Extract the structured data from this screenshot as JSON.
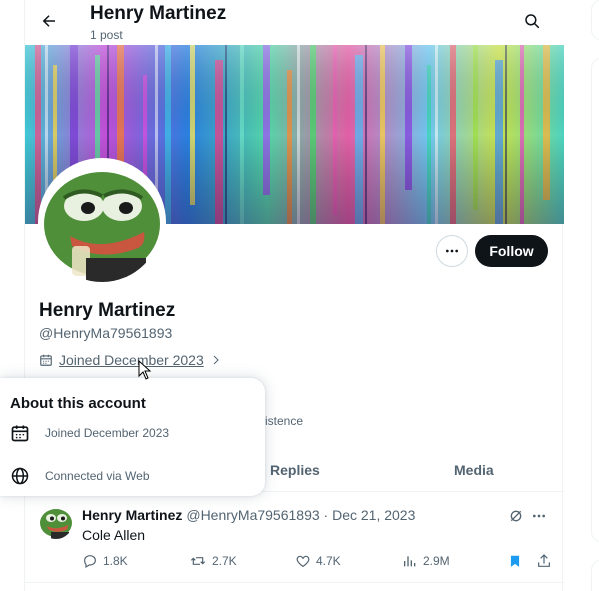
{
  "header": {
    "name": "Henry Martinez",
    "post_count": "1 post"
  },
  "profile": {
    "name": "Henry Martinez",
    "handle": "@HenryMa79561893",
    "joined": "Joined December 2023",
    "follow_label": "Follow",
    "bio_fragment": "istence"
  },
  "tabs": [
    {
      "label": "Replies"
    },
    {
      "label": "Media"
    }
  ],
  "post": {
    "author": "Henry Martinez",
    "meta": "@HenryMa79561893 · Dec 21, 2023",
    "text": "Cole Allen",
    "replies": "1.8K",
    "reposts": "2.7K",
    "likes": "4.7K",
    "views": "2.9M"
  },
  "popup": {
    "title": "About this account",
    "joined": "Joined December 2023",
    "connected": "Connected via Web"
  },
  "colors": {
    "accent": "#1d9bf0",
    "text": "#0f1419",
    "muted": "#536471",
    "follow_bg": "#0f1419"
  },
  "icons": [
    "back-arrow-icon",
    "search-icon",
    "more-icon",
    "calendar-icon",
    "chevron-right-icon",
    "globe-icon",
    "reply-icon",
    "repost-icon",
    "like-icon",
    "views-icon",
    "bookmark-icon",
    "share-icon",
    "grok-icon"
  ]
}
